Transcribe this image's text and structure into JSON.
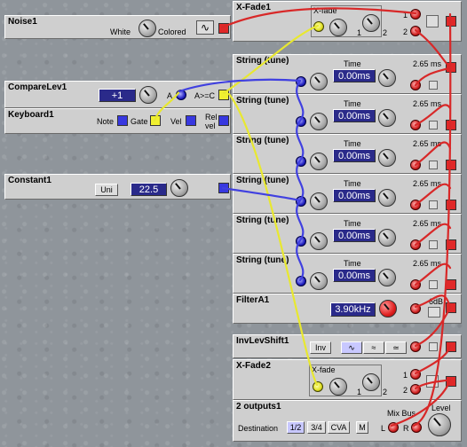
{
  "noise": {
    "title": "Noise1",
    "white": "White",
    "colored": "Colored"
  },
  "compare": {
    "title": "CompareLev1",
    "value": "+1",
    "a": "A",
    "agc": "A>=C"
  },
  "keyboard": {
    "title": "Keyboard1",
    "note": "Note",
    "gate": "Gate",
    "vel": "Vel",
    "relvel1": "Rel",
    "relvel2": "vel"
  },
  "constant": {
    "title": "Constant1",
    "uni": "Uni",
    "value": "22.5"
  },
  "xfade1": {
    "title": "X-Fade1",
    "label": "X-fade",
    "in1": "1",
    "in2": "2",
    "o1": "1",
    "o2": "2"
  },
  "strings": [
    {
      "title": "String (tune)",
      "time_label": "Time",
      "time": "0.00ms",
      "freq": "2.65 ms"
    },
    {
      "title": "String (tune)",
      "time_label": "Time",
      "time": "0.00ms",
      "freq": "2.65 ms"
    },
    {
      "title": "String (tune)",
      "time_label": "Time",
      "time": "0.00ms",
      "freq": "2.65 ms"
    },
    {
      "title": "String (tune)",
      "time_label": "Time",
      "time": "0.00ms",
      "freq": "2.65 ms"
    },
    {
      "title": "String (tune)",
      "time_label": "Time",
      "time": "0.00ms",
      "freq": "2.65 ms"
    },
    {
      "title": "String (tune)",
      "time_label": "Time",
      "time": "0.00ms",
      "freq": "2.65 ms"
    }
  ],
  "filter": {
    "title": "FilterA1",
    "freq": "3.90kHz",
    "db": "6dB"
  },
  "invlev": {
    "title": "InvLevShift1",
    "inv": "Inv"
  },
  "xfade2": {
    "title": "X-Fade2",
    "label": "X-fade",
    "in1": "1",
    "in2": "2",
    "o1": "1",
    "o2": "2"
  },
  "outputs": {
    "title": "2 outputs1",
    "destination": "Destination",
    "b12": "1/2",
    "b34": "3/4",
    "cva": "CVA",
    "m": "M",
    "mixbus": "Mix Bus",
    "level": "Level",
    "l": "L",
    "r": "R"
  },
  "colors": {
    "red": "#e02828",
    "blue": "#3838e0",
    "yellow": "#f0f030",
    "panel": "#cfcfcf"
  }
}
